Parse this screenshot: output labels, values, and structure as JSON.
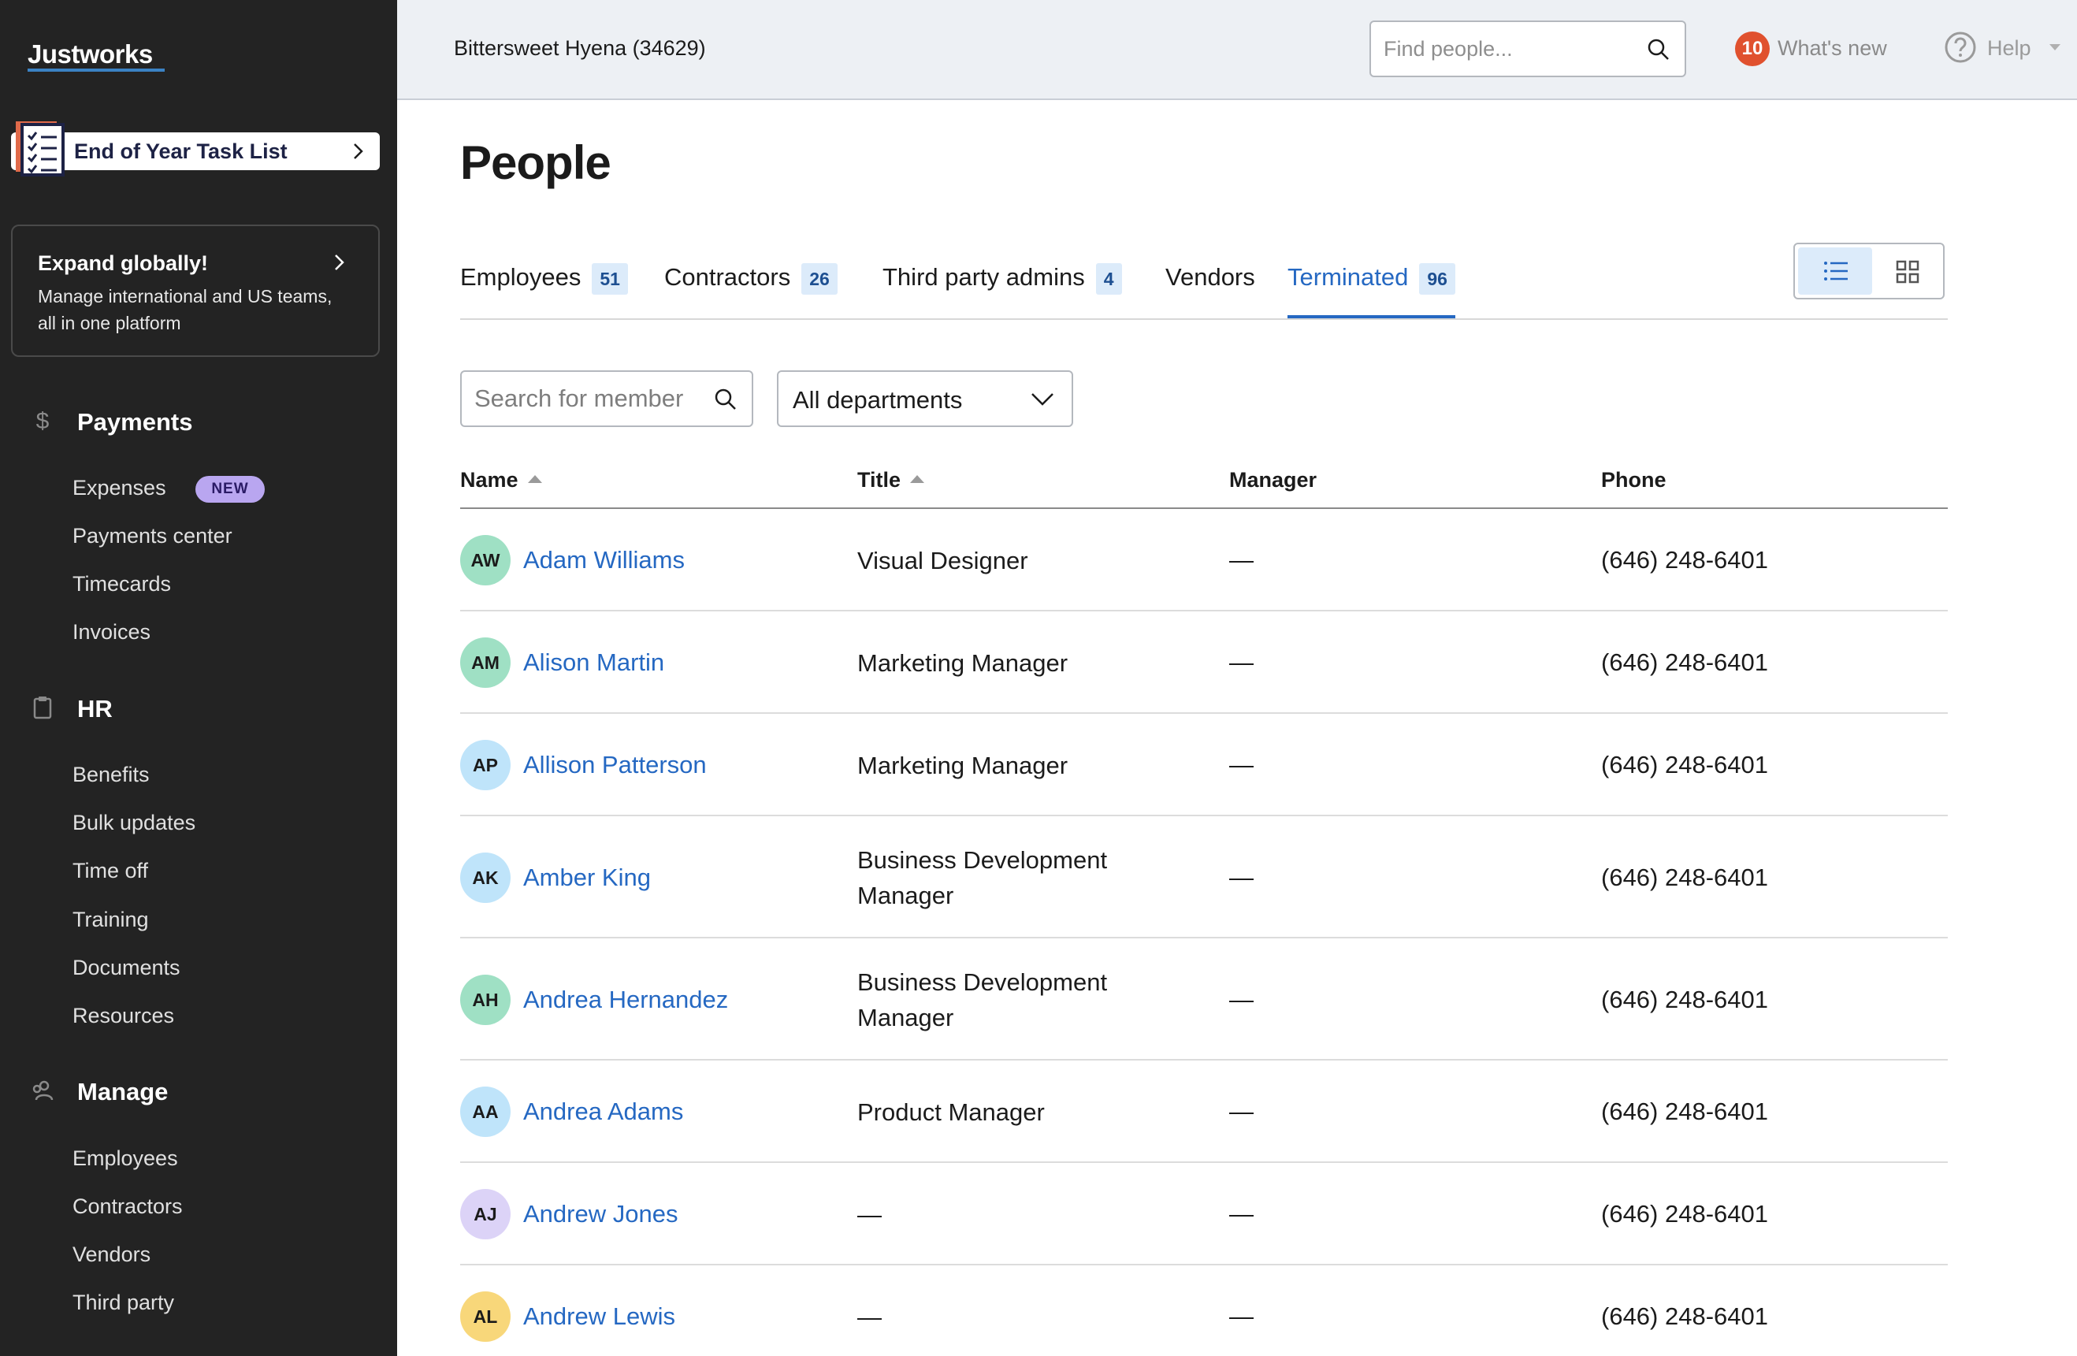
{
  "app": {
    "logo": "Justworks"
  },
  "sidebar": {
    "task_card": {
      "label": "End of Year Task List"
    },
    "expand_card": {
      "title": "Expand globally!",
      "description": "Manage international and US teams, all in one platform"
    },
    "sections": [
      {
        "heading": "Payments",
        "icon": "dollar-icon",
        "items": [
          {
            "label": "Expenses",
            "badge": "NEW"
          },
          {
            "label": "Payments center"
          },
          {
            "label": "Timecards"
          },
          {
            "label": "Invoices"
          }
        ]
      },
      {
        "heading": "HR",
        "icon": "clipboard-icon",
        "items": [
          {
            "label": "Benefits"
          },
          {
            "label": "Bulk updates"
          },
          {
            "label": "Time off"
          },
          {
            "label": "Training"
          },
          {
            "label": "Documents"
          },
          {
            "label": "Resources"
          }
        ]
      },
      {
        "heading": "Manage",
        "icon": "people-icon",
        "items": [
          {
            "label": "Employees"
          },
          {
            "label": "Contractors"
          },
          {
            "label": "Vendors"
          },
          {
            "label": "Third party"
          }
        ]
      }
    ]
  },
  "topbar": {
    "company": "Bittersweet Hyena (34629)",
    "search_placeholder": "Find people...",
    "whats_new_count": "10",
    "whats_new_label": "What's new",
    "help_label": "Help"
  },
  "main": {
    "title": "People",
    "tabs": [
      {
        "label": "Employees",
        "count": "51"
      },
      {
        "label": "Contractors",
        "count": "26"
      },
      {
        "label": "Third party admins",
        "count": "4"
      },
      {
        "label": "Vendors",
        "count": ""
      },
      {
        "label": "Terminated",
        "count": "96",
        "active": true
      }
    ],
    "filters": {
      "search_placeholder": "Search for member",
      "department": "All departments"
    },
    "table": {
      "columns": [
        "Name",
        "Title",
        "Manager",
        "Phone"
      ],
      "rows": [
        {
          "initials": "AW",
          "name": "Adam Williams",
          "title": "Visual Designer",
          "manager": "—",
          "phone": "(646) 248-6401",
          "avatar_color": "#9fe0c4"
        },
        {
          "initials": "AM",
          "name": "Alison Martin",
          "title": "Marketing Manager",
          "manager": "—",
          "phone": "(646) 248-6401",
          "avatar_color": "#9fe0c4"
        },
        {
          "initials": "AP",
          "name": "Allison Patterson",
          "title": "Marketing Manager",
          "manager": "—",
          "phone": "(646) 248-6401",
          "avatar_color": "#bfe4fa"
        },
        {
          "initials": "AK",
          "name": "Amber King",
          "title": "Business Development Manager",
          "manager": "—",
          "phone": "(646) 248-6401",
          "avatar_color": "#bfe4fa"
        },
        {
          "initials": "AH",
          "name": "Andrea Hernandez",
          "title": "Business Development Manager",
          "manager": "—",
          "phone": "(646) 248-6401",
          "avatar_color": "#9fe0c4"
        },
        {
          "initials": "AA",
          "name": "Andrea Adams",
          "title": "Product Manager",
          "manager": "—",
          "phone": "(646) 248-6401",
          "avatar_color": "#bfe4fa"
        },
        {
          "initials": "AJ",
          "name": "Andrew Jones",
          "title": "—",
          "manager": "—",
          "phone": "(646) 248-6401",
          "avatar_color": "#dcd3f7"
        },
        {
          "initials": "AL",
          "name": "Andrew Lewis",
          "title": "—",
          "manager": "—",
          "phone": "(646) 248-6401",
          "avatar_color": "#f8d77a"
        }
      ]
    }
  }
}
